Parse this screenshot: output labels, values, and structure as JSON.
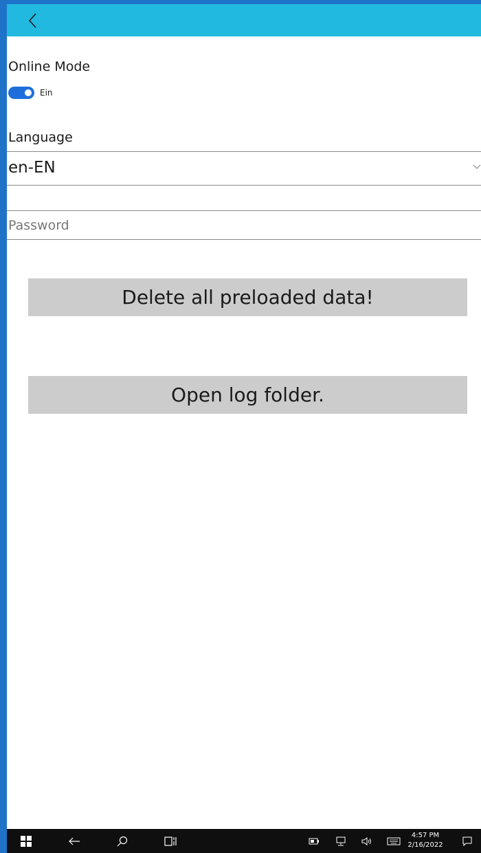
{
  "header": {
    "back_icon": "chevron-left-icon",
    "background": "#22b9e0"
  },
  "settings": {
    "online_mode_label": "Online Mode",
    "online_mode_state": "Ein",
    "online_mode_on": true,
    "language_label": "Language",
    "language_value": "en-EN",
    "password_placeholder": "Password"
  },
  "actions": {
    "delete_label": "Delete all preloaded data!",
    "open_log_label": "Open log folder."
  },
  "taskbar": {
    "time": "4:57 PM",
    "date": "2/16/2022",
    "icons": [
      "windows-start-icon",
      "back-arrow-icon",
      "search-icon",
      "task-view-icon",
      "battery-icon",
      "network-icon",
      "volume-icon",
      "keyboard-icon",
      "notification-icon"
    ]
  },
  "colors": {
    "accent": "#1e6fdc",
    "frame": "#1e72c8",
    "button": "#cccccc",
    "taskbar": "#0f0f10"
  }
}
